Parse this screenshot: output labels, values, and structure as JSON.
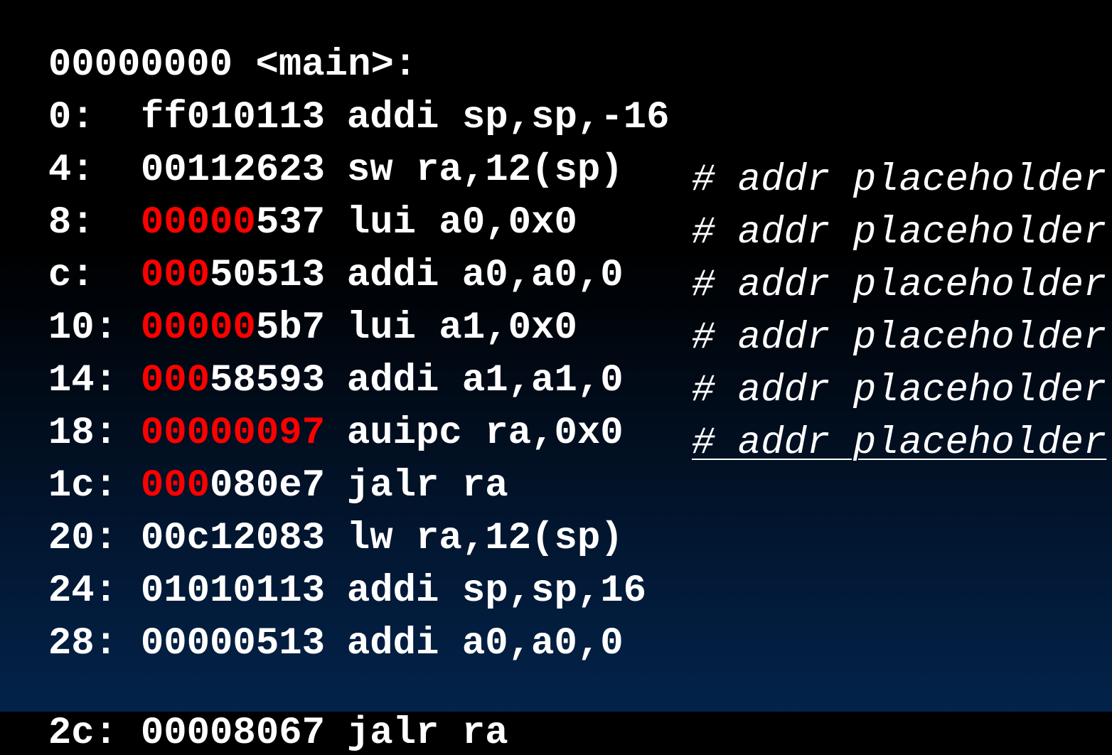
{
  "header": "00000000 <main>:",
  "lines": [
    {
      "addr": "0:",
      "hex_red": "",
      "hex_white": "ff010113",
      "instr": "addi sp,sp,-16",
      "comment": ""
    },
    {
      "addr": "4:",
      "hex_red": "",
      "hex_white": "00112623",
      "instr": "sw ra,12(sp)",
      "comment": ""
    },
    {
      "addr": "8:",
      "hex_red": "00000",
      "hex_white": "537",
      "instr": "lui a0,0x0",
      "comment": "# addr placeholder"
    },
    {
      "addr": "c:",
      "hex_red": "000",
      "hex_white": "50513",
      "instr": "addi a0,a0,0",
      "comment": "# addr placeholder"
    },
    {
      "addr": "10:",
      "hex_red": "00000",
      "hex_white": "5b7",
      "instr": "lui a1,0x0",
      "comment": "# addr placeholder"
    },
    {
      "addr": "14:",
      "hex_red": "000",
      "hex_white": "58593",
      "instr": "addi a1,a1,0",
      "comment": "# addr placeholder"
    },
    {
      "addr": "18:",
      "hex_red": "00000097",
      "hex_white": "",
      "instr": "auipc ra,0x0",
      "comment": "# addr placeholder"
    },
    {
      "addr": "1c:",
      "hex_red": "000",
      "hex_white": "080e7",
      "instr": "jalr ra",
      "comment": "# addr placeholder"
    },
    {
      "addr": "20:",
      "hex_red": "",
      "hex_white": "00c12083",
      "instr": "lw ra,12(sp)",
      "comment": ""
    },
    {
      "addr": "24:",
      "hex_red": "",
      "hex_white": "01010113",
      "instr": "addi sp,sp,16",
      "comment": ""
    },
    {
      "addr": "28:",
      "hex_red": "",
      "hex_white": "00000513",
      "instr": "addi a0,a0,0",
      "comment": ""
    },
    {
      "addr": "2c:",
      "hex_red": "",
      "hex_white": "00008067",
      "instr": "jalr ra",
      "comment": ""
    }
  ]
}
